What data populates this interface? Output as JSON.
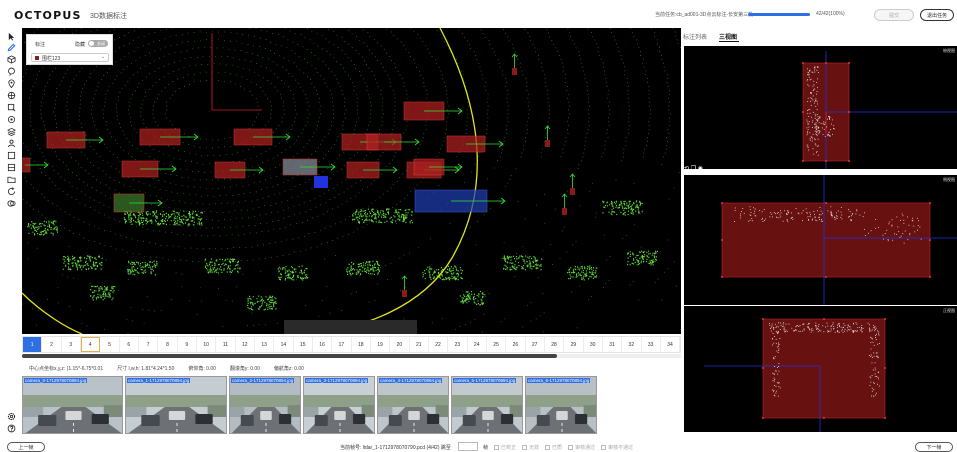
{
  "header": {
    "logo": "OCTOPUS",
    "subtitle": "3D数据标注",
    "task_label": "当前任务:cb_ad001-3D点云标注-长安第三批",
    "progress_text": "42/42(100%)",
    "progress_fraction": 1.0,
    "save_button": "提交",
    "exit_button": "退出任务"
  },
  "toolbar": {
    "tools": [
      "cursor-icon",
      "pen-icon",
      "cube-icon",
      "lasso-icon",
      "pin-icon",
      "target-icon",
      "box-select-icon",
      "ring-icon",
      "stack-icon",
      "person-icon",
      "square-icon",
      "frame-icon",
      "folder-icon",
      "refresh-icon",
      "layers-icon"
    ],
    "bottom_tools": [
      "settings-icon",
      "help-icon"
    ]
  },
  "label_panel": {
    "title": "标注",
    "hide_label": "隐藏",
    "toggle_text": "关闭",
    "selected_class": "围栏123",
    "selected_color": "#8a2020"
  },
  "frames": [
    "1",
    "2",
    "3",
    "4",
    "5",
    "6",
    "7",
    "8",
    "9",
    "10",
    "11",
    "12",
    "13",
    "14",
    "15",
    "16",
    "17",
    "18",
    "19",
    "20",
    "21",
    "22",
    "23",
    "24",
    "25",
    "26",
    "27",
    "28",
    "29",
    "30",
    "31",
    "32",
    "33",
    "34"
  ],
  "frames_state": {
    "active_index": 0,
    "marked_index": 3
  },
  "info_row": [
    "中心点坐标x,y,z: (1.15*-6.75*0.01",
    "尺寸 l,w,h: 1.81*4.24*1.50",
    "俯仰角: 0.00",
    "翻滚角y: 0.00",
    "偏航角z: 0.00"
  ],
  "cameras": [
    {
      "label": "camera_0-1712978070894.jpg"
    },
    {
      "label": "camera_1-1712978070894.jpg"
    },
    {
      "label": "camera_2-1712978070894.jpg"
    },
    {
      "label": "camera_3-1712978070894.jpg"
    },
    {
      "label": "camera_4-1712978070894.jpg"
    },
    {
      "label": "camera_5-1712978070894.jpg"
    },
    {
      "label": "camera_6-1712978070894.jpg"
    }
  ],
  "right_panel": {
    "tabs": [
      "标注列表",
      "三视图"
    ],
    "active_tab": 1,
    "views": [
      "俯视图",
      "侧视图",
      "正视图"
    ]
  },
  "footer": {
    "prev_button": "上一帧",
    "next_button": "下一帧",
    "frame_info": "当前帧号: lidar_1-1712978070790.pcd (4/42)",
    "jump_label": "跳至",
    "jump_suffix": "帧",
    "checkboxes": [
      "已校正",
      "无效",
      "已质",
      "审核通过",
      "审核不通过"
    ]
  },
  "colors": {
    "accent": "#2f6fe4",
    "box_red": "#b02020",
    "box_blue": "#1f3fb0",
    "points": "#3fbf2a",
    "ring": "#e4e41a"
  }
}
